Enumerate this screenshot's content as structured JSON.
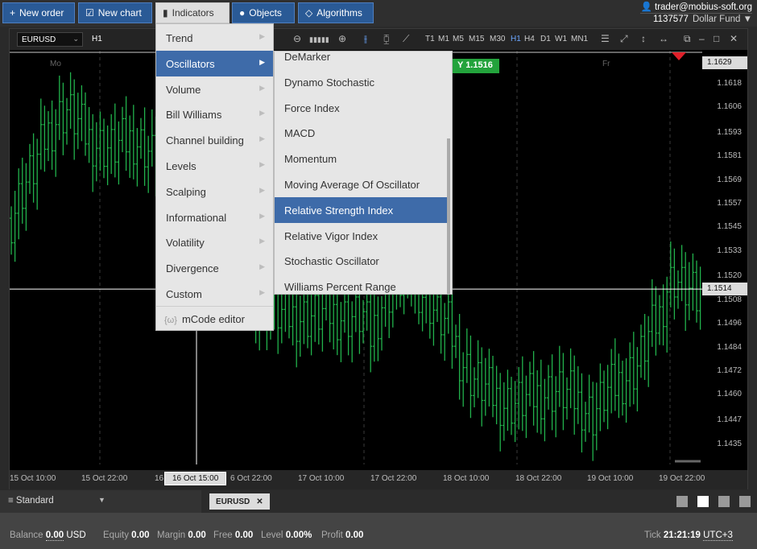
{
  "toolbar": {
    "new_order": "New order",
    "new_chart": "New chart",
    "indicators": "Indicators",
    "objects": "Objects",
    "algorithms": "Algorithms"
  },
  "account": {
    "user": "trader@mobius-soft.org",
    "number": "1137577",
    "fund": "Dollar Fund"
  },
  "chart": {
    "symbol": "EURUSD",
    "timeframe": "H1",
    "timeframes": [
      "T1",
      "M1",
      "M5",
      "M15",
      "M30",
      "H1",
      "H4",
      "D1",
      "W1",
      "MN1"
    ],
    "active_timeframe": "H1",
    "buy_tag": "Y 1.1516",
    "day_labels": [
      "Mo",
      "Fr"
    ]
  },
  "menu": {
    "items": [
      {
        "label": "Trend"
      },
      {
        "label": "Oscillators"
      },
      {
        "label": "Volume"
      },
      {
        "label": "Bill Williams"
      },
      {
        "label": "Channel building"
      },
      {
        "label": "Levels"
      },
      {
        "label": "Scalping"
      },
      {
        "label": "Informational"
      },
      {
        "label": "Volatility"
      },
      {
        "label": "Divergence"
      },
      {
        "label": "Custom"
      }
    ],
    "selected": "Oscillators",
    "mcode_icon": "{ω}",
    "mcode": "mCode editor"
  },
  "submenu": {
    "items": [
      "DeMarker",
      "Dynamo Stochastic",
      "Force Index",
      "MACD",
      "Momentum",
      "Moving Average Of Oscillator",
      "Relative Strength Index",
      "Relative Vigor Index",
      "Stochastic Oscillator",
      "Williams Percent Range"
    ],
    "selected": "Relative Strength Index"
  },
  "chart_data": {
    "type": "ohlc",
    "title": "",
    "symbol": "EURUSD",
    "timeframe": "H1",
    "x_axis_labels": [
      "15 Oct 10:00",
      "15 Oct 22:00",
      "16",
      "6 Oct 22:00",
      "17 Oct 10:00",
      "17 Oct 22:00",
      "18 Oct 10:00",
      "18 Oct 22:00",
      "19 Oct 10:00",
      "19 Oct 22:00"
    ],
    "crosshair_x_label": "16 Oct 15:00",
    "y_axis_labels": [
      "1.1618",
      "1.1606",
      "1.1593",
      "1.1581",
      "1.1569",
      "1.1557",
      "1.1545",
      "1.1533",
      "1.1520",
      "1.1508",
      "1.1496",
      "1.1484",
      "1.1472",
      "1.1460",
      "1.1447",
      "1.1435"
    ],
    "y_tags": {
      "top": "1.1629",
      "current": "1.1514"
    },
    "ylim": [
      1.1425,
      1.1635
    ],
    "grid": false,
    "price_path": [
      [
        0,
        1.155
      ],
      [
        3,
        1.1565
      ],
      [
        6,
        1.1575
      ],
      [
        9,
        1.159
      ],
      [
        12,
        1.16
      ],
      [
        15,
        1.1605
      ],
      [
        18,
        1.1598
      ],
      [
        21,
        1.159
      ],
      [
        24,
        1.1587
      ],
      [
        27,
        1.1585
      ],
      [
        30,
        1.1588
      ],
      [
        33,
        1.159
      ],
      [
        36,
        1.1586
      ],
      [
        39,
        1.158
      ],
      [
        42,
        1.157
      ],
      [
        60,
        1.1525
      ],
      [
        65,
        1.151
      ],
      [
        70,
        1.1503
      ],
      [
        75,
        1.15
      ],
      [
        80,
        1.15
      ],
      [
        85,
        1.1502
      ],
      [
        90,
        1.15
      ],
      [
        95,
        1.15
      ],
      [
        97,
        1.149
      ],
      [
        100,
        1.1507
      ],
      [
        103,
        1.1515
      ],
      [
        106,
        1.152
      ],
      [
        109,
        1.1517
      ],
      [
        112,
        1.151
      ],
      [
        115,
        1.15
      ],
      [
        118,
        1.1495
      ],
      [
        121,
        1.148
      ],
      [
        124,
        1.147
      ],
      [
        127,
        1.1465
      ],
      [
        130,
        1.146
      ],
      [
        133,
        1.1456
      ],
      [
        136,
        1.1456
      ],
      [
        139,
        1.1458
      ],
      [
        142,
        1.146
      ],
      [
        145,
        1.1462
      ],
      [
        148,
        1.1462
      ],
      [
        151,
        1.146
      ],
      [
        154,
        1.1455
      ],
      [
        157,
        1.145
      ],
      [
        160,
        1.146
      ],
      [
        163,
        1.1465
      ],
      [
        166,
        1.147
      ],
      [
        169,
        1.1475
      ],
      [
        172,
        1.149
      ],
      [
        175,
        1.15
      ],
      [
        177,
        1.1515
      ],
      [
        179,
        1.152
      ],
      [
        181,
        1.1515
      ],
      [
        183,
        1.1512
      ],
      [
        185,
        1.1508
      ],
      [
        187,
        1.151
      ]
    ]
  },
  "tabs": {
    "layout": "Standard",
    "chart_tab": "EURUSD"
  },
  "status": {
    "balance_label": "Balance",
    "balance": "0.00",
    "currency": "USD",
    "equity_label": "Equity",
    "equity": "0.00",
    "margin_label": "Margin",
    "margin": "0.00",
    "free_label": "Free",
    "free": "0.00",
    "level_label": "Level",
    "level": "0.00%",
    "profit_label": "Profit",
    "profit": "0.00",
    "tick_label": "Tick",
    "tick": "21:21:19",
    "tz": "UTC+3"
  }
}
